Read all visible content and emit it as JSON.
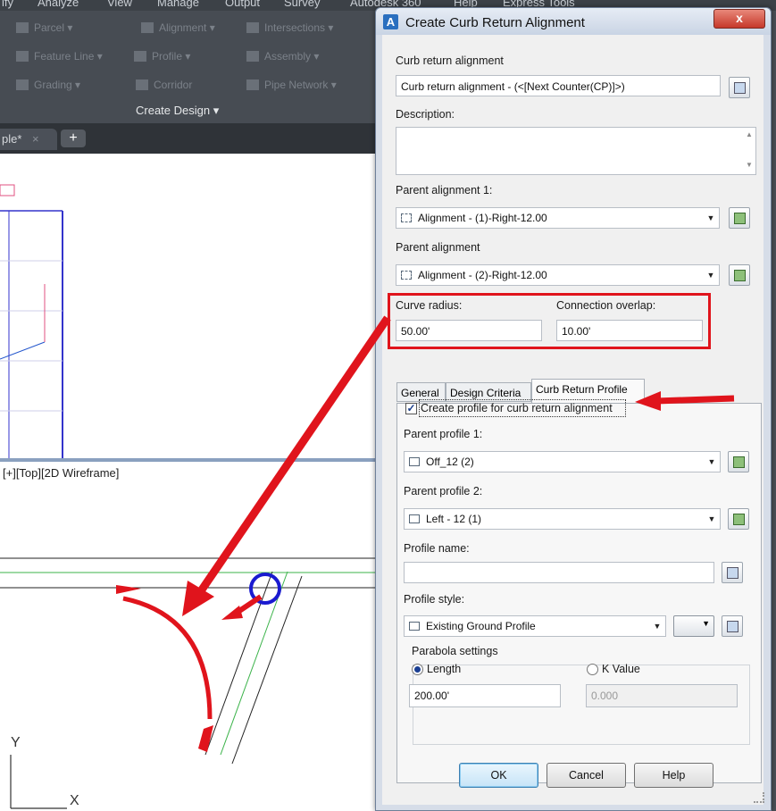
{
  "app": {
    "menu": [
      "ify",
      "Analyze",
      "View",
      "Manage",
      "Output",
      "Survey",
      "Autodesk 360",
      "Help",
      "Express Tools"
    ],
    "ribbon_items": [
      "Parcel ▾",
      "Alignment ▾",
      "Intersections ▾",
      "Feature Line ▾",
      "Profile ▾",
      "Assembly ▾",
      "Grading ▾",
      "Corridor",
      "Pipe Network ▾"
    ],
    "panel_title": "Create Design ▾",
    "doc_tab": "ple*",
    "doc_tab_close": "×",
    "new_tab": "+",
    "viewport_label": "[+][Top][2D Wireframe]",
    "ucs_y": "Y",
    "ucs_x": "X"
  },
  "dialog": {
    "title": "Create Curb Return Alignment",
    "app_icon": "A",
    "close": "x",
    "curb_return_alignment_label": "Curb return alignment",
    "curb_return_alignment_value": "Curb return alignment - (<[Next Counter(CP)]>)",
    "description_label": "Description:",
    "description_value": "",
    "parent_alignment_1_label": "Parent alignment 1:",
    "parent_alignment_1_value": "Alignment - (1)-Right-12.00",
    "parent_alignment_2_label": "Parent alignment",
    "parent_alignment_2_value": "Alignment - (2)-Right-12.00",
    "curve_radius_label": "Curve radius:",
    "curve_radius_value": "50.00'",
    "connection_overlap_label": "Connection overlap:",
    "connection_overlap_value": "10.00'",
    "tabs": [
      "General",
      "Design Criteria",
      "Curb Return Profile"
    ],
    "create_profile_label": "Create profile for curb return alignment",
    "create_profile_checked": "✓",
    "parent_profile_1_label": "Parent profile 1:",
    "parent_profile_1_value": "Off_12 (2)",
    "parent_profile_2_label": "Parent profile 2:",
    "parent_profile_2_value": "Left - 12 (1)",
    "profile_name_label": "Profile name:",
    "profile_name_value": "",
    "profile_style_label": "Profile style:",
    "profile_style_value": "Existing Ground Profile",
    "parabola_settings_label": "Parabola settings",
    "length_label": "Length",
    "k_value_label": "K Value",
    "length_value": "200.00'",
    "k_value_value": "0.000",
    "ok": "OK",
    "cancel": "Cancel",
    "help": "Help"
  },
  "colors": {
    "annotation_red": "#e0141c",
    "dialog_bg": "#f0f0f0",
    "accent_blue": "#2a6fbf"
  }
}
